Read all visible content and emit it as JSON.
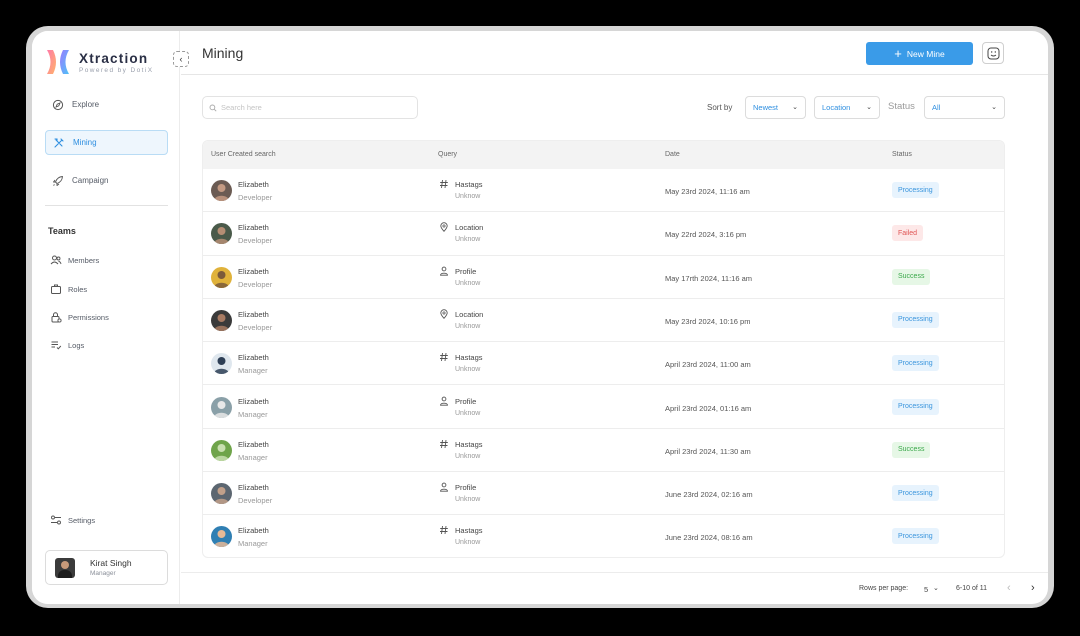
{
  "brand": {
    "title": "Xtraction",
    "subtitle": "Powered by DotiX"
  },
  "sidebar": {
    "items": [
      {
        "label": "Explore",
        "icon": "compass-icon"
      },
      {
        "label": "Mining",
        "icon": "tools-icon",
        "active": true
      },
      {
        "label": "Campaign",
        "icon": "rocket-icon"
      }
    ],
    "teams_title": "Teams",
    "team_items": [
      {
        "label": "Members",
        "icon": "users-icon"
      },
      {
        "label": "Roles",
        "icon": "briefcase-icon"
      },
      {
        "label": "Permissions",
        "icon": "lock-icon"
      },
      {
        "label": "Logs",
        "icon": "list-check-icon"
      }
    ],
    "settings_label": "Settings",
    "user": {
      "name": "Kirat Singh",
      "role": "Manager"
    }
  },
  "header": {
    "title": "Mining",
    "new_button": "New Mine"
  },
  "filters": {
    "search_placeholder": "Search here",
    "sort_label": "Sort by",
    "sort_value": "Newest",
    "location_value": "Location",
    "status_label": "Status",
    "status_value": "All"
  },
  "table": {
    "columns": [
      "User Created search",
      "Query",
      "Date",
      "Status"
    ],
    "rows": [
      {
        "name": "Elizabeth",
        "role": "Developer",
        "query_type": "Hastags",
        "query_icon": "hash-icon",
        "query_value": "Unknow",
        "date": "May 23rd 2024, 11:16 am",
        "status": "Processing"
      },
      {
        "name": "Elizabeth",
        "role": "Developer",
        "query_type": "Location",
        "query_icon": "location-pin-icon",
        "query_value": "Unknow",
        "date": "May 22rd 2024, 3:16 pm",
        "status": "Failed"
      },
      {
        "name": "Elizabeth",
        "role": "Developer",
        "query_type": "Profile",
        "query_icon": "person-icon",
        "query_value": "Unknow",
        "date": "May 17rth 2024, 11:16 am",
        "status": "Success"
      },
      {
        "name": "Elizabeth",
        "role": "Developer",
        "query_type": "Location",
        "query_icon": "location-pin-icon",
        "query_value": "Unknow",
        "date": "May 23rd 2024, 10:16 pm",
        "status": "Processing"
      },
      {
        "name": "Elizabeth",
        "role": "Manager",
        "query_type": "Hastags",
        "query_icon": "hash-icon",
        "query_value": "Unknow",
        "date": "April 23rd 2024, 11:00 am",
        "status": "Processing"
      },
      {
        "name": "Elizabeth",
        "role": "Manager",
        "query_type": "Profile",
        "query_icon": "person-icon",
        "query_value": "Unknow",
        "date": "April 23rd 2024, 01:16 am",
        "status": "Processing"
      },
      {
        "name": "Elizabeth",
        "role": "Manager",
        "query_type": "Hastags",
        "query_icon": "hash-icon",
        "query_value": "Unknow",
        "date": "April 23rd 2024, 11:30 am",
        "status": "Success"
      },
      {
        "name": "Elizabeth",
        "role": "Developer",
        "query_type": "Profile",
        "query_icon": "person-icon",
        "query_value": "Unknow",
        "date": "June 23rd 2024, 02:16 am",
        "status": "Processing"
      },
      {
        "name": "Elizabeth",
        "role": "Manager",
        "query_type": "Hastags",
        "query_icon": "hash-icon",
        "query_value": "Unknow",
        "date": "June 23rd 2024, 08:16 am",
        "status": "Processing"
      }
    ]
  },
  "pagination": {
    "rows_per_page_label": "Rows per page:",
    "rows_per_page": "5",
    "range": "6-10 of 11"
  },
  "colors": {
    "accent": "#3a9be8",
    "processing_bg": "#e7f3fd",
    "processing_text": "#3a95dd",
    "failed_bg": "#fde8e8",
    "failed_text": "#e05555",
    "success_bg": "#e6f7e6",
    "success_text": "#3aa84a"
  }
}
